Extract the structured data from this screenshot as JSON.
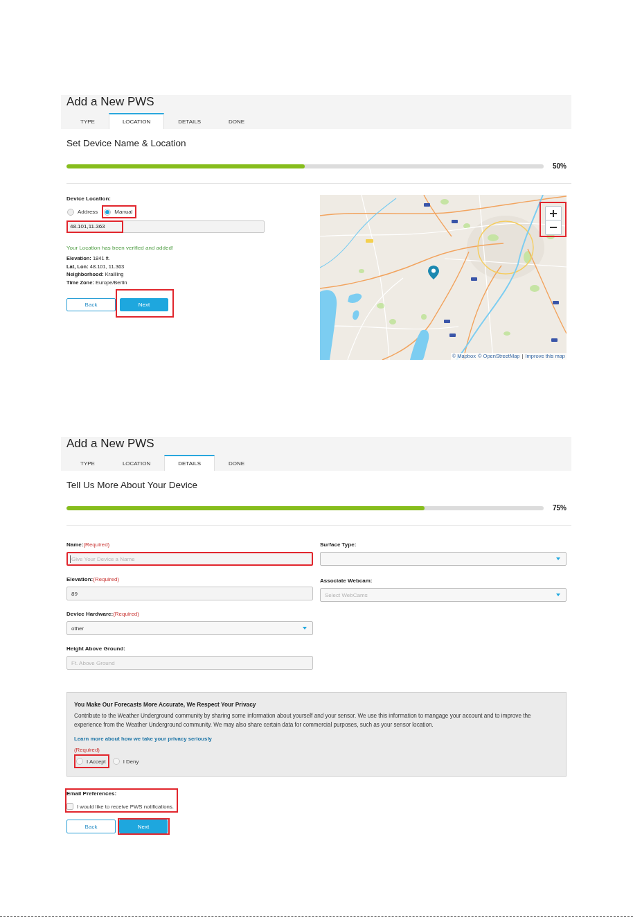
{
  "steps": [
    {
      "kind": "location",
      "title": "Add a New PWS",
      "tabs": [
        {
          "label": "TYPE",
          "selected": false
        },
        {
          "label": "LOCATION",
          "selected": true
        },
        {
          "label": "DETAILS",
          "selected": false
        },
        {
          "label": "DONE",
          "selected": false
        }
      ],
      "heading": "Set Device Name & Location",
      "progress": {
        "level": 0.5,
        "reading": "50%"
      },
      "location": {
        "label": "Device Location:",
        "options": [
          {
            "label": "Address",
            "selected": false,
            "highlighted": false
          },
          {
            "label": "Manual",
            "selected": true,
            "highlighted": true
          }
        ],
        "coordinates": {
          "value": "48.101,11.363",
          "highlighted": true
        },
        "status": "Your Location has been verified and added!",
        "info": [
          "**Elevation:** 1841 ft.",
          "**Lat, Lon:** 48.101, 11.363",
          "**Neighborhood:** Krailling",
          "**Time Zone:** Europe/Berlin"
        ]
      },
      "map": {
        "zoom_highlighted": true,
        "attribution_links": [
          "© Mapbox",
          "© OpenStreetMap"
        ],
        "attribution_separator": "|",
        "improve_link": "Improve this map"
      },
      "buttons": [
        {
          "label": "Back",
          "kind": "back",
          "highlighted": false
        },
        {
          "label": "Next",
          "kind": "next",
          "highlighted": true
        }
      ]
    },
    {
      "kind": "details",
      "title": "Add a New PWS",
      "tabs": [
        {
          "label": "TYPE",
          "selected": false
        },
        {
          "label": "LOCATION",
          "selected": false
        },
        {
          "label": "DETAILS",
          "selected": true
        },
        {
          "label": "DONE",
          "selected": false
        }
      ],
      "heading": "Tell Us More About Your Device",
      "progress": {
        "level": 0.75,
        "reading": "75%"
      },
      "fields_left": [
        {
          "kind": "input",
          "label": "Name:",
          "required": "(Required)",
          "placeholder": "Give Your Device a Name",
          "highlighted": true,
          "focused": true
        },
        {
          "kind": "input",
          "label": "Elevation:",
          "required": "(Required)",
          "value": "89",
          "highlighted": false,
          "focused": false
        },
        {
          "kind": "select",
          "label": "Device Hardware:",
          "required": "(Required)",
          "value": "other",
          "highlighted": false,
          "focused": false
        },
        {
          "kind": "input",
          "label": "Height Above Ground:",
          "placeholder": "Ft. Above Ground",
          "highlighted": false,
          "focused": false
        }
      ],
      "fields_right": [
        {
          "kind": "select",
          "label": "Surface Type:",
          "highlighted": false,
          "focused": false
        },
        {
          "kind": "select",
          "label": "Associate Webcam:",
          "placeholder": "Select WebCams",
          "highlighted": false,
          "focused": false
        }
      ],
      "privacy": {
        "title": "You Make Our Forecasts More Accurate, We Respect Your Privacy",
        "text": "Contribute to the Weather Underground community by sharing some information about yourself and your sensor. We use this information to mangage your account and to improve the experience from the Weather Underground community. We may also share certain data for commercial purposes, such as your sensor location.",
        "link": "Learn more about how we take your privacy seriously",
        "required": "(Required)",
        "options": [
          {
            "label": "I Accept",
            "selected": false,
            "highlighted": true
          },
          {
            "label": "I Deny",
            "selected": false,
            "highlighted": false
          }
        ]
      },
      "email": {
        "label": "Email Preferences:",
        "checkbox": {
          "label": "I would like to receive PWS notifications.",
          "checked": false
        },
        "highlighted": true
      },
      "buttons": [
        {
          "label": "Back",
          "kind": "back",
          "highlighted": false
        },
        {
          "label": "Next",
          "kind": "next",
          "highlighted": true
        }
      ]
    }
  ]
}
